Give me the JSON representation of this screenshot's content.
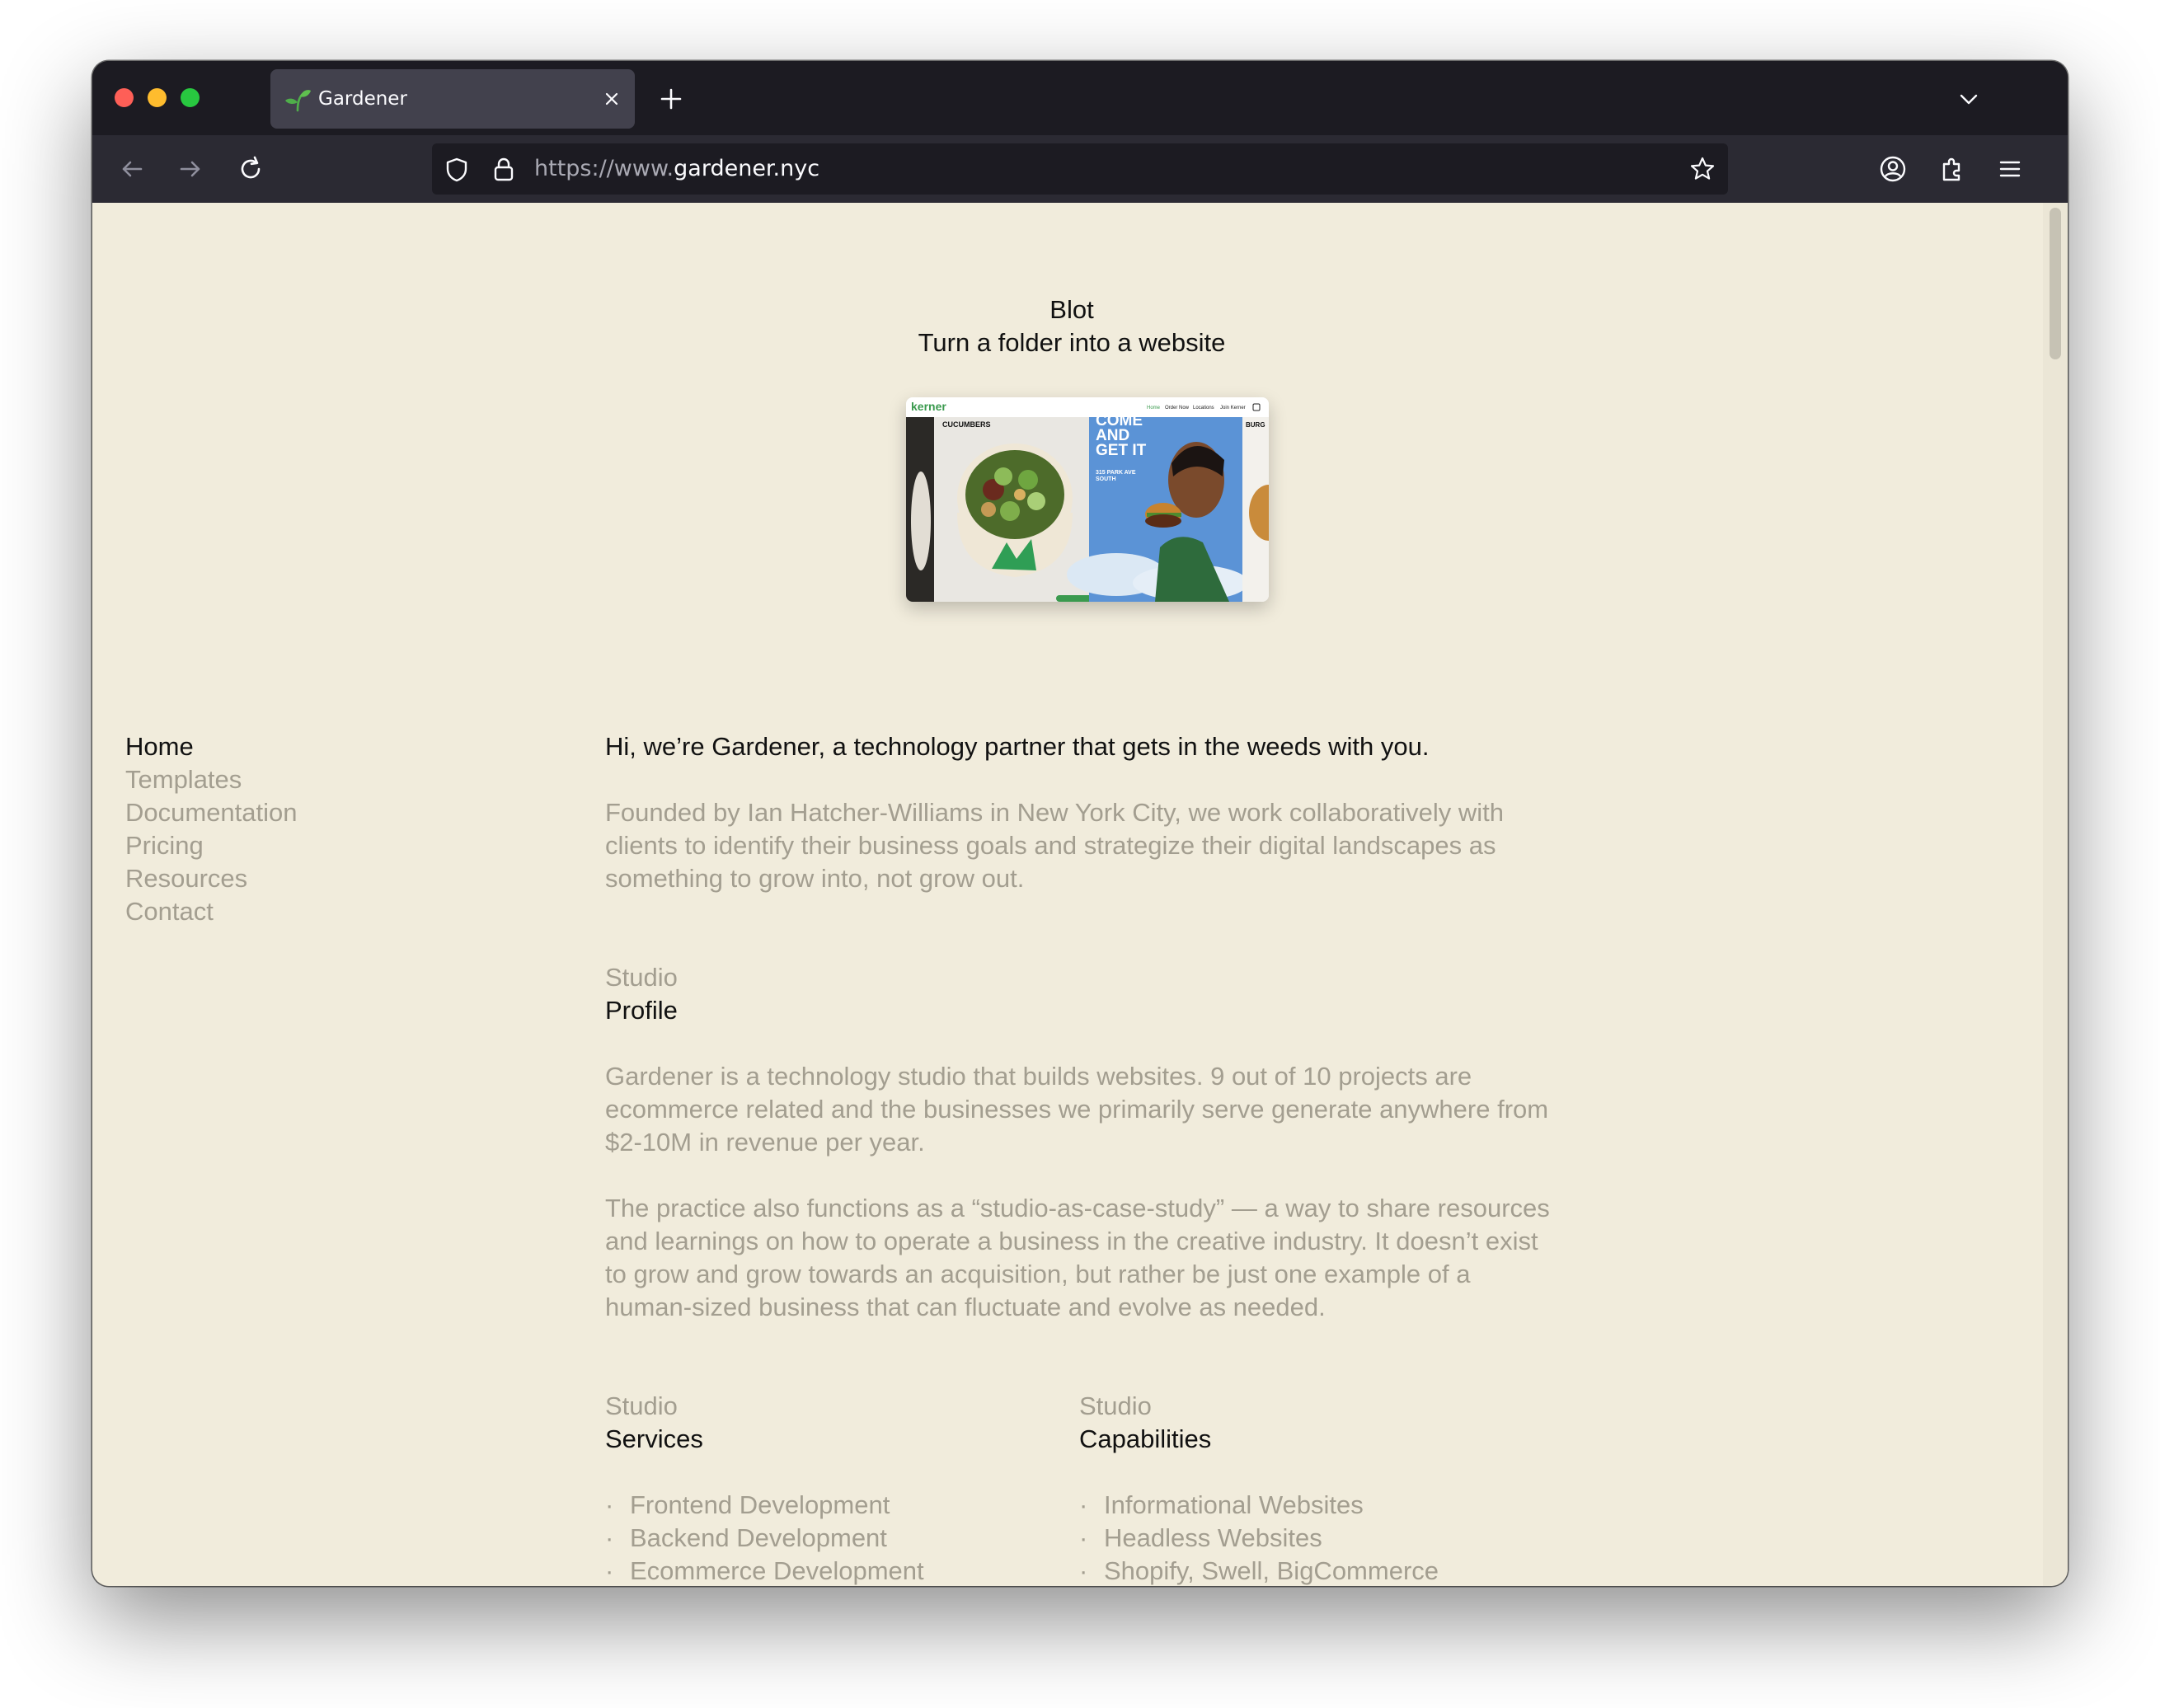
{
  "browser": {
    "tab": {
      "title": "Gardener"
    },
    "url": {
      "prefix": "https://www.",
      "domain": "gardener.nyc"
    }
  },
  "site": {
    "title": "Blot",
    "tagline": "Turn a folder into a website"
  },
  "hero_image": {
    "brand": "kerner",
    "nav": [
      "Home",
      "Order Now",
      "Locations",
      "Join Kerner"
    ],
    "panel_left": "CUCUMBERS",
    "headline": [
      "COME",
      "AND",
      "GET IT"
    ],
    "address": [
      "315 PARK AVE",
      "SOUTH"
    ],
    "panel_right": "BURG"
  },
  "sidebar": {
    "items": [
      {
        "label": "Home",
        "active": true
      },
      {
        "label": "Templates",
        "active": false
      },
      {
        "label": "Documentation",
        "active": false
      },
      {
        "label": "Pricing",
        "active": false
      },
      {
        "label": "Resources",
        "active": false
      },
      {
        "label": "Contact",
        "active": false
      }
    ]
  },
  "main": {
    "intro": "Hi, we’re Gardener, a technology partner that gets in the weeds with you.",
    "founded": "Founded by Ian Hatcher-Williams in New York City, we work collaboratively with clients to identify their business goals and strategize their digital landscapes as something to grow into, not grow out.",
    "profile": {
      "kicker": "Studio",
      "heading": "Profile",
      "paragraphs": [
        "Gardener is a technology studio that builds websites. 9 out of 10 projects are ecommerce related and the businesses we primarily serve generate anywhere from $2-10M in revenue per year.",
        "The practice also functions as a “studio-as-case-study” — a way to share resources and learnings on how to operate a business in the creative industry. It doesn’t exist to grow and grow towards an acquisition, but rather be just one example of a human-sized business that can fluctuate and evolve as needed."
      ]
    },
    "services": {
      "kicker": "Studio",
      "heading": "Services",
      "items": [
        "Frontend Development",
        "Backend Development",
        "Ecommerce Development"
      ]
    },
    "capabilities": {
      "kicker": "Studio",
      "heading": "Capabilities",
      "items": [
        "Informational Websites",
        "Headless Websites",
        "Shopify, Swell, BigCommerce"
      ]
    },
    "bullet": "·"
  },
  "colors": {
    "page_bg": "#f1ecdc",
    "text_dark": "#111111",
    "text_muted": "#a39e90",
    "browser_chrome": "#1c1b22",
    "brand_green": "#3a9a4e"
  }
}
